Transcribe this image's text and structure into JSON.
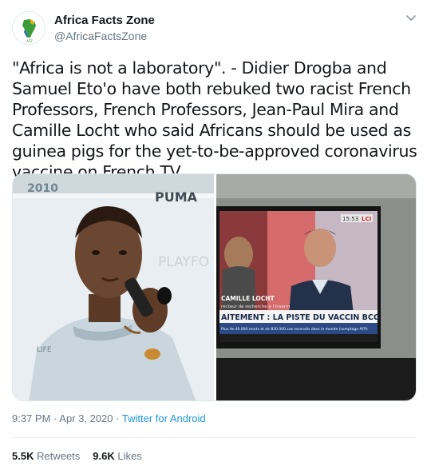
{
  "author": {
    "name": "Africa Facts Zone",
    "handle": "@AfricaFactsZone",
    "avatar_icon": "africa-map-logo-icon"
  },
  "tweet": {
    "text": "\"Africa is not a laboratory\". - Didier Drogba and Samuel Eto'o have both rebuked two racist French Professors, French Professors, Jean-Paul Mira and Camille Locht who said Africans should be used as guinea pigs for the yet-to-be-approved coronavirus vaccine on French TV."
  },
  "media": {
    "left_image": {
      "banner_text": "PUMA",
      "backdrop_text": "PLAYFO",
      "logo_text": "2010",
      "shirt_text": "LIFE"
    },
    "right_image": {
      "channel": "LCI",
      "clock": "15:53",
      "caption_name": "CAMILLE LOCHT",
      "caption_role": "recteur de recherche à l'Inserm",
      "ticker_headline": "AITEMENT : LA PISTE DU VACCIN BCG",
      "ticker_sub": "Plus de 40 000 morts et de 830 000 cas recensés dans le monde (comptage AFP)"
    }
  },
  "meta": {
    "time": "9:37 PM",
    "separator": "·",
    "date": "Apr 3, 2020",
    "source": "Twitter for Android"
  },
  "stats": {
    "retweets_count": "5.5K",
    "retweets_label": "Retweets",
    "likes_count": "9.6K",
    "likes_label": "Likes"
  },
  "colors": {
    "text": "#14171a",
    "secondary": "#657786",
    "link": "#1b95e0",
    "border": "#e1e8ed"
  }
}
